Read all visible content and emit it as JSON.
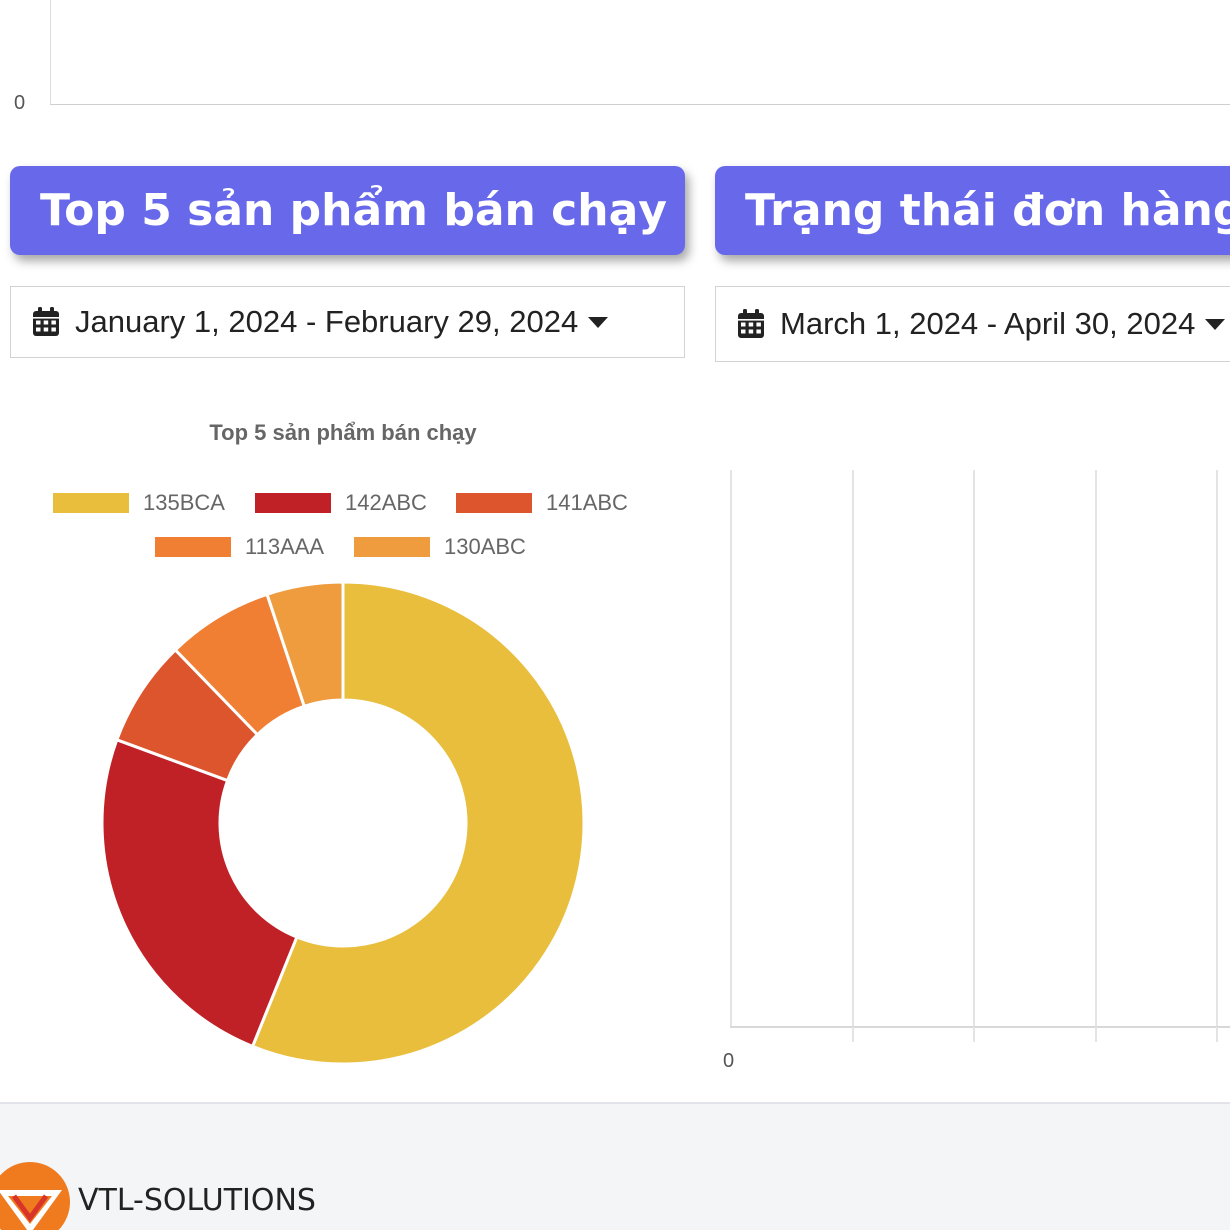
{
  "top_chart": {
    "zero_label": "0"
  },
  "left_card": {
    "title": "Top 5 sản phẩm bán chạy",
    "date_range": "January 1, 2024 - February 29, 2024"
  },
  "right_card": {
    "title": "Trạng thái đơn hàng",
    "date_range": "March 1, 2024 - April 30, 2024",
    "zero_label": "0"
  },
  "chart_data": {
    "type": "pie",
    "donut": true,
    "title": "Top 5 sản phẩm bán chạy",
    "legend_position": "top",
    "categories": [
      "135BCA",
      "142ABC",
      "141ABC",
      "113AAA",
      "130ABC"
    ],
    "values": [
      55,
      24,
      7,
      7,
      5
    ],
    "colors": [
      "#e8be3c",
      "#c02126",
      "#dd552d",
      "#f07f34",
      "#ee9c3d"
    ]
  },
  "footer": {
    "logo_icon": "vtl-logo-icon",
    "brand": "VTL-SOLUTIONS"
  },
  "icons": {
    "calendar": "calendar-icon",
    "caret": "caret-down-icon"
  }
}
